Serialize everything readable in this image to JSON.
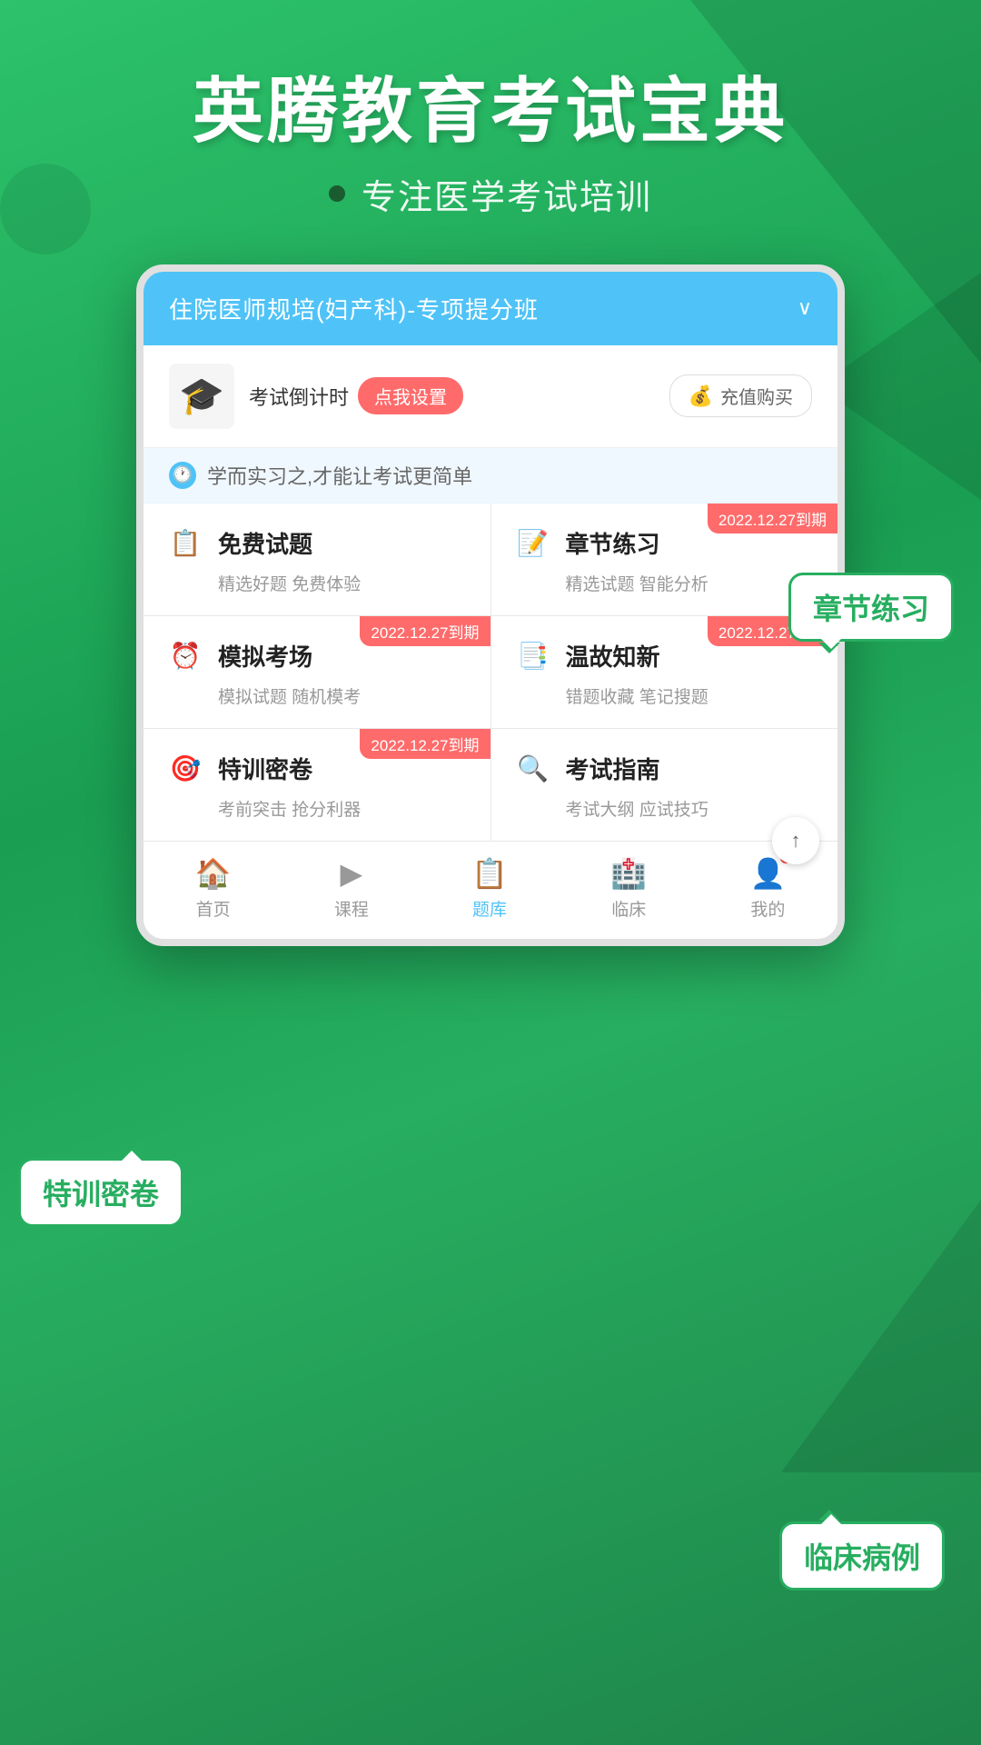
{
  "app": {
    "main_title": "英腾教育考试宝典",
    "sub_title": "专注医学考试培训",
    "header_course": "住院医师规培(妇产科)-专项提分班",
    "countdown_label": "考试倒计时",
    "set_btn": "点我设置",
    "recharge_btn": "充值购买",
    "motto": "学而实习之,才能让考试更简单",
    "cards": [
      {
        "id": "free-questions",
        "icon": "📋",
        "icon_color": "#4fc3f7",
        "title": "免费试题",
        "desc": "精选好题 免费体验",
        "expiry": null
      },
      {
        "id": "chapter-practice",
        "icon": "📝",
        "icon_color": "#4fc3f7",
        "title": "章节练习",
        "desc": "精选试题 智能分析",
        "expiry": "2022.12.27到期"
      },
      {
        "id": "mock-exam",
        "icon": "⏰",
        "icon_color": "#ffa500",
        "title": "模拟考场",
        "desc": "模拟试题 随机模考",
        "expiry": "2022.12.27到期"
      },
      {
        "id": "review",
        "icon": "📑",
        "icon_color": "#4fc3f7",
        "title": "温故知新",
        "desc": "错题收藏 笔记搜题",
        "expiry": "2022.12.27到期"
      },
      {
        "id": "secret-exam",
        "icon": "🎯",
        "icon_color": "#ff6b6b",
        "title": "特训密卷",
        "desc": "考前突击 抢分利器",
        "expiry": "2022.12.27到期"
      },
      {
        "id": "exam-guide",
        "icon": "🔍",
        "icon_color": "#ff6b6b",
        "title": "考试指南",
        "desc": "考试大纲 应试技巧",
        "expiry": null
      }
    ],
    "nav_items": [
      {
        "id": "home",
        "icon": "🏠",
        "label": "首页",
        "active": false
      },
      {
        "id": "course",
        "icon": "▶",
        "label": "课程",
        "active": false
      },
      {
        "id": "questions",
        "icon": "📋",
        "label": "题库",
        "active": true
      },
      {
        "id": "clinical",
        "icon": "🏥",
        "label": "临床",
        "active": false
      },
      {
        "id": "mine",
        "icon": "👤",
        "label": "我的",
        "active": false,
        "badge": true
      }
    ],
    "callouts": {
      "chapter": "章节练习",
      "secret": "特训密卷",
      "clinical": "临床病例"
    }
  }
}
